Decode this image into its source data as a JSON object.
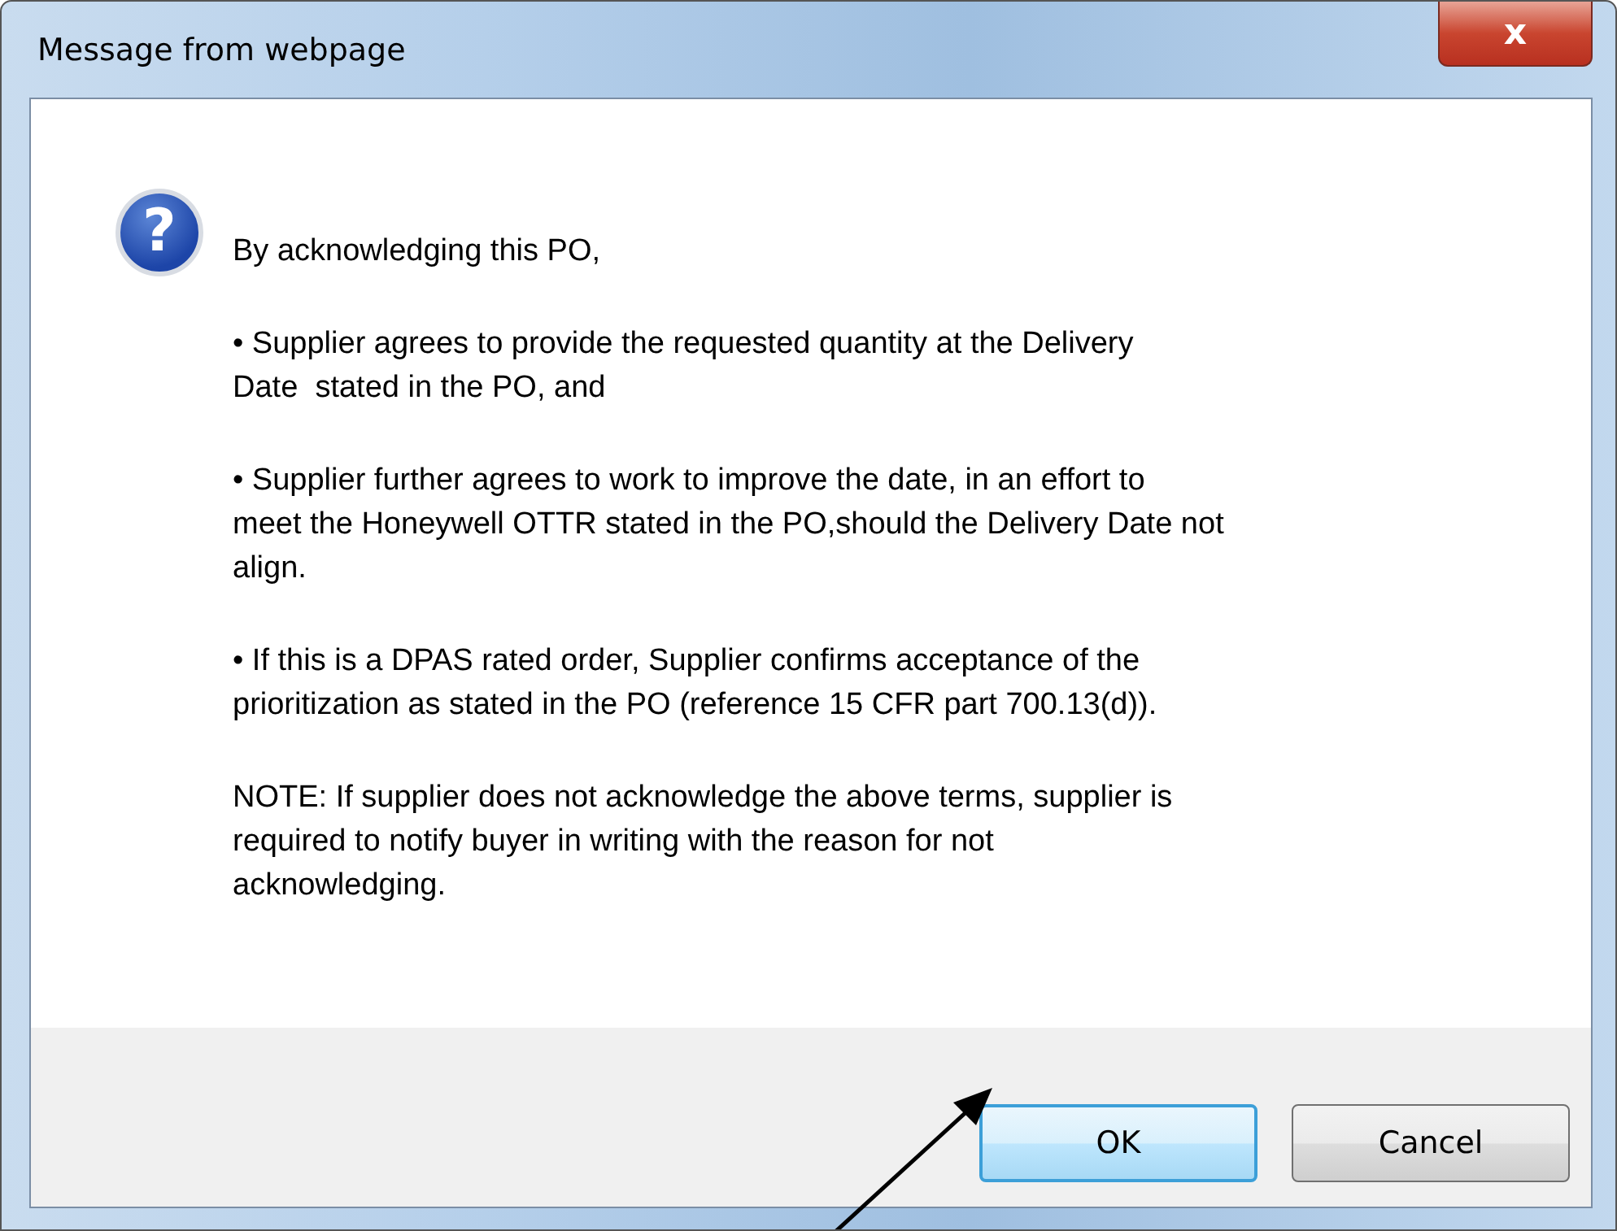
{
  "window": {
    "title": "Message from webpage",
    "close_glyph": "x"
  },
  "message": {
    "icon_glyph": "?",
    "paragraphs": [
      {
        "lines": [
          "By acknowledging this PO,"
        ]
      },
      {
        "lines": [
          "• Supplier agrees to provide the requested quantity at the Delivery",
          "Date  stated in the PO, and"
        ]
      },
      {
        "lines": [
          "• Supplier further agrees to work to improve the date, in an effort to",
          "meet the Honeywell OTTR stated in the PO,should the Delivery Date not",
          "align."
        ]
      },
      {
        "lines": [
          "• If this is a DPAS rated order, Supplier confirms acceptance of the",
          "prioritization as stated in the PO (reference 15 CFR part 700.13(d))."
        ]
      },
      {
        "lines": [
          "NOTE: If supplier does not acknowledge the above terms, supplier is",
          "required to notify buyer in writing with the reason for not",
          "acknowledging."
        ]
      }
    ]
  },
  "buttons": [
    {
      "label": "OK",
      "selected": true
    },
    {
      "label": "Cancel",
      "selected": false
    }
  ]
}
